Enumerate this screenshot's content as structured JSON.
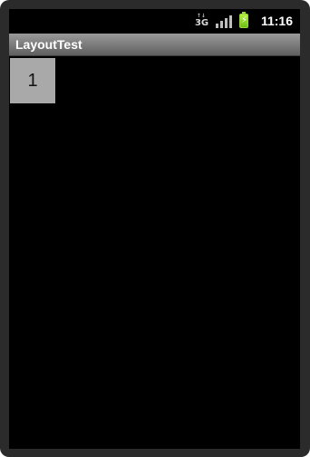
{
  "status_bar": {
    "network_label": "3G",
    "data_arrows": "↑↓",
    "time": "11:16",
    "icons": [
      "network-3g-icon",
      "signal-strength-icon",
      "battery-charging-icon"
    ],
    "colors": {
      "battery": "#9ad53a",
      "text": "#ffffff"
    }
  },
  "app": {
    "title": "LayoutTest"
  },
  "content": {
    "cells": [
      "1"
    ],
    "colors": {
      "cell_bg": "#a9a9a9",
      "background": "#000000"
    }
  }
}
